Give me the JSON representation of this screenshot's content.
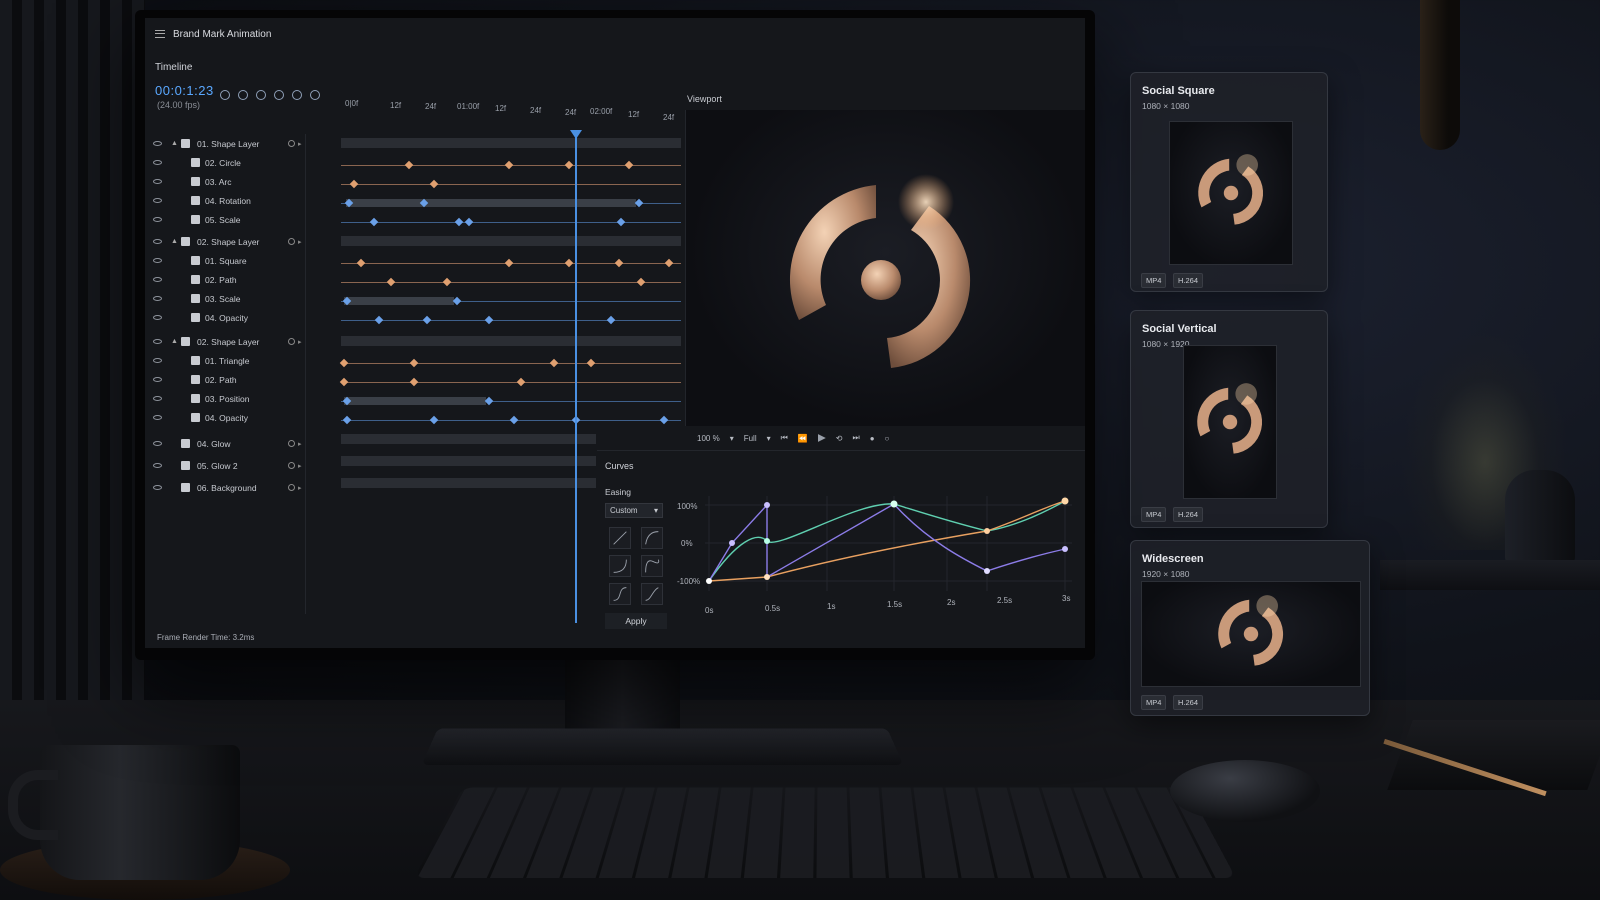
{
  "app": {
    "title": "Brand Mark Animation",
    "status": "Frame Render Time: 3.2ms"
  },
  "timeline": {
    "label": "Timeline",
    "timecode": "00:0:1:23",
    "fps": "(24.00 fps)",
    "ruler": [
      "0|0f",
      "12f",
      "24f",
      "01:00f",
      "12f",
      "24f",
      "24f",
      "02:00f",
      "12f",
      "24f"
    ],
    "layers": [
      {
        "name": "01. Shape Layer",
        "group": true
      },
      {
        "name": "02. Circle",
        "group": false
      },
      {
        "name": "03. Arc",
        "group": false
      },
      {
        "name": "04. Rotation",
        "group": false
      },
      {
        "name": "05. Scale",
        "group": false
      },
      {
        "name": "02. Shape Layer",
        "group": true
      },
      {
        "name": "01. Square",
        "group": false
      },
      {
        "name": "02. Path",
        "group": false
      },
      {
        "name": "03. Scale",
        "group": false
      },
      {
        "name": "04. Opacity",
        "group": false
      },
      {
        "name": "02. Shape Layer",
        "group": true
      },
      {
        "name": "01. Triangle",
        "group": false
      },
      {
        "name": "02. Path",
        "group": false
      },
      {
        "name": "03. Position",
        "group": false
      },
      {
        "name": "04. Opacity",
        "group": false
      },
      {
        "name": "04. Glow",
        "group": true
      },
      {
        "name": "05. Glow 2",
        "group": true
      },
      {
        "name": "06. Background",
        "group": true
      }
    ]
  },
  "viewport": {
    "label": "Viewport",
    "zoom": "100 %",
    "resolution": "Full"
  },
  "curves": {
    "label": "Curves",
    "easing_label": "Easing",
    "easing_value": "Custom",
    "apply_label": "Apply",
    "y_labels": [
      "100%",
      "0%",
      "-100%"
    ],
    "x_labels": [
      "0s",
      "0.5s",
      "1s",
      "1.5s",
      "2s",
      "2.5s",
      "3s"
    ],
    "colors": {
      "teal": "#5fcfb0",
      "orange": "#e8a060",
      "purple": "#8c7ce8"
    }
  },
  "exports": [
    {
      "title": "Social Square",
      "dims": "1080 × 1080",
      "format": "MP4",
      "codec": "H.264"
    },
    {
      "title": "Social Vertical",
      "dims": "1080 × 1920",
      "format": "MP4",
      "codec": "H.264"
    },
    {
      "title": "Widescreen",
      "dims": "1920 × 1080",
      "format": "MP4",
      "codec": "H.264"
    }
  ],
  "icons": {
    "menu": "hamburger-icon",
    "visibility": "eye-icon",
    "play": "play-icon"
  }
}
